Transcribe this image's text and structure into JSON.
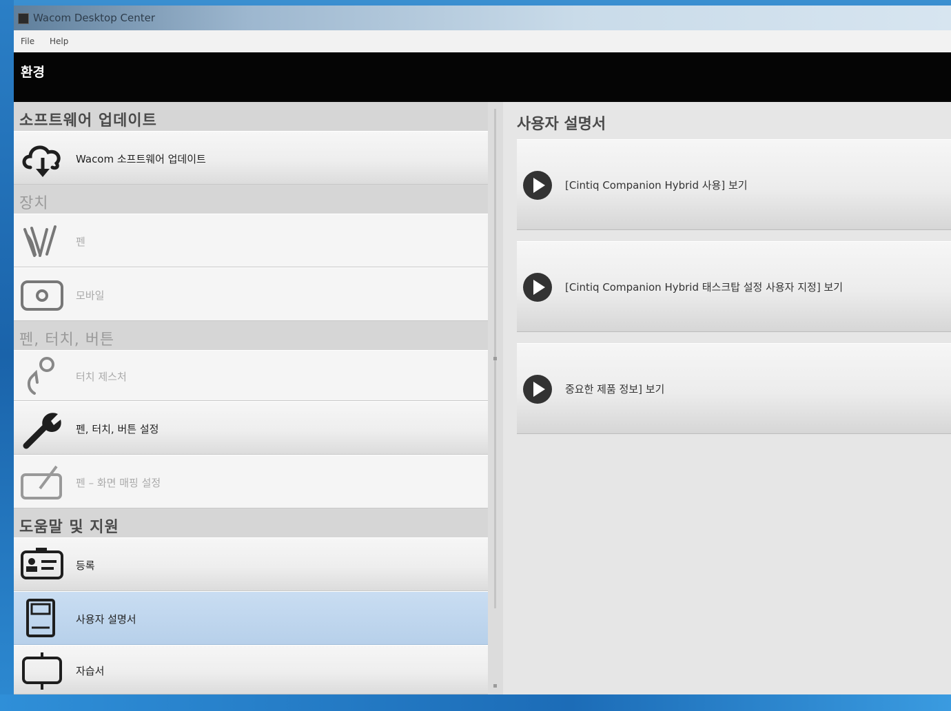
{
  "window": {
    "title": "Wacom Desktop Center"
  },
  "menu": [
    "File",
    "Help"
  ],
  "header": {
    "title": "환경"
  },
  "left": {
    "sections": [
      {
        "title": "소프트웨어 업데이트",
        "items": [
          {
            "label": "Wacom 소프트웨어 업데이트",
            "icon": "cloud-download-icon",
            "state": "normal"
          }
        ]
      },
      {
        "title": "장치",
        "items": [
          {
            "label": "펜",
            "icon": "pens-icon",
            "state": "disabled"
          },
          {
            "label": "모바일",
            "icon": "tablet-icon",
            "state": "disabled"
          }
        ]
      },
      {
        "title": "펜, 터치, 버튼",
        "items": [
          {
            "label": "터치 제스처",
            "icon": "touch-gesture-icon",
            "state": "disabled"
          },
          {
            "label": "펜, 터치, 버튼 설정",
            "icon": "wrench-icon",
            "state": "normal"
          },
          {
            "label": "펜 – 화면 매핑 설정",
            "icon": "display-mapping-icon",
            "state": "disabled"
          }
        ]
      },
      {
        "title": "도움말 및 지원",
        "items": [
          {
            "label": "등록",
            "icon": "id-card-icon",
            "state": "normal"
          },
          {
            "label": "사용자 설명서",
            "icon": "manual-icon",
            "state": "selected"
          },
          {
            "label": "자습서",
            "icon": "tutorial-icon",
            "state": "normal"
          }
        ]
      }
    ]
  },
  "right": {
    "title": "사용자 설명서",
    "items": [
      {
        "label": "[Cintiq Companion Hybrid 사용] 보기"
      },
      {
        "label": "[Cintiq Companion Hybrid 태스크탑 설정 사용자 지정] 보기"
      },
      {
        "label": "중요한 제품 정보] 보기"
      }
    ]
  },
  "colors": {
    "selected": "#b7d0ea",
    "header_bar": "#050505",
    "accent_blue": "#1f6fb8"
  }
}
